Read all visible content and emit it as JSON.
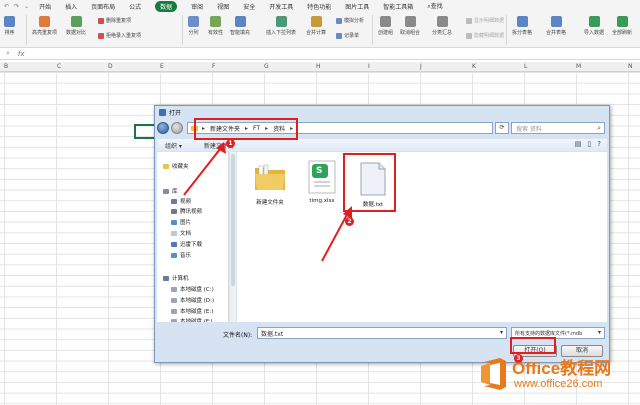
{
  "ribbon": {
    "menu_tabs": [
      "开始",
      "插入",
      "页面布局",
      "公式",
      "数据",
      "审阅",
      "视图",
      "安全",
      "开发工具",
      "特色功能",
      "图片工具",
      "智能工具箱"
    ],
    "active_tab": "数据",
    "search_label": "查找",
    "buttons": {
      "sort": "排序",
      "highlight_dup": "高亮重复项",
      "data_compare": "数据对比",
      "remove_dup": "删除重复项",
      "reject_dup": "拒绝录入重复项",
      "split": "分列",
      "validity": "有效性",
      "fill": "智能填充",
      "insert_dropdown": "插入下拉列表",
      "merge_calc": "合并计算",
      "simulate": "模拟分析",
      "record": "记录单",
      "create_group": "创建组",
      "ungroup": "取消组合",
      "subtotal": "分类汇总",
      "show_detail": "显示明细数据",
      "hide_detail": "隐藏明细数据",
      "split_table": "拆分表格",
      "merge_table": "合并表格",
      "import": "导入数据",
      "refresh_all": "全部刷新"
    }
  },
  "grid": {
    "columns": [
      "B",
      "C",
      "D",
      "E",
      "F",
      "G",
      "H",
      "I",
      "J",
      "K",
      "L",
      "M",
      "N"
    ]
  },
  "dialog": {
    "title": "打开",
    "breadcrumbs": [
      "新建文件夹",
      "FT",
      "资料"
    ],
    "search_placeholder": "搜索 资料",
    "toolbar": {
      "organize": "组织 ▾",
      "new_folder": "新建文件夹"
    },
    "nav": {
      "favorites": "收藏夹",
      "library": "库",
      "lib_items": [
        "视频",
        "腾讯视频",
        "图片",
        "文档",
        "迅雷下载",
        "音乐"
      ],
      "computer": "计算机",
      "drives": [
        "本地磁盘 (C:)",
        "本地磁盘 (D:)",
        "本地磁盘 (E:)",
        "本地磁盘 (F:)"
      ]
    },
    "files": [
      {
        "name": "新建文件夹",
        "type": "folder"
      },
      {
        "name": "timg.xlsx",
        "type": "xlsx",
        "letter": "S"
      },
      {
        "name": "数据.txt",
        "type": "txt"
      }
    ],
    "filename_label": "文件名(N):",
    "filename_value": "数据.txt",
    "filter_value": "所有支持的数据库文件(*.mdb",
    "open_button": "打开(O)",
    "cancel_button": "取消"
  },
  "annotations": {
    "badges": [
      "1",
      "2",
      "3"
    ]
  },
  "watermark": {
    "title": "Office教程网",
    "url": "www.office26.com"
  },
  "colors": {
    "accent_green": "#1b7a3e",
    "annotation_red": "#e02020",
    "watermark_orange": "#e8791c"
  }
}
